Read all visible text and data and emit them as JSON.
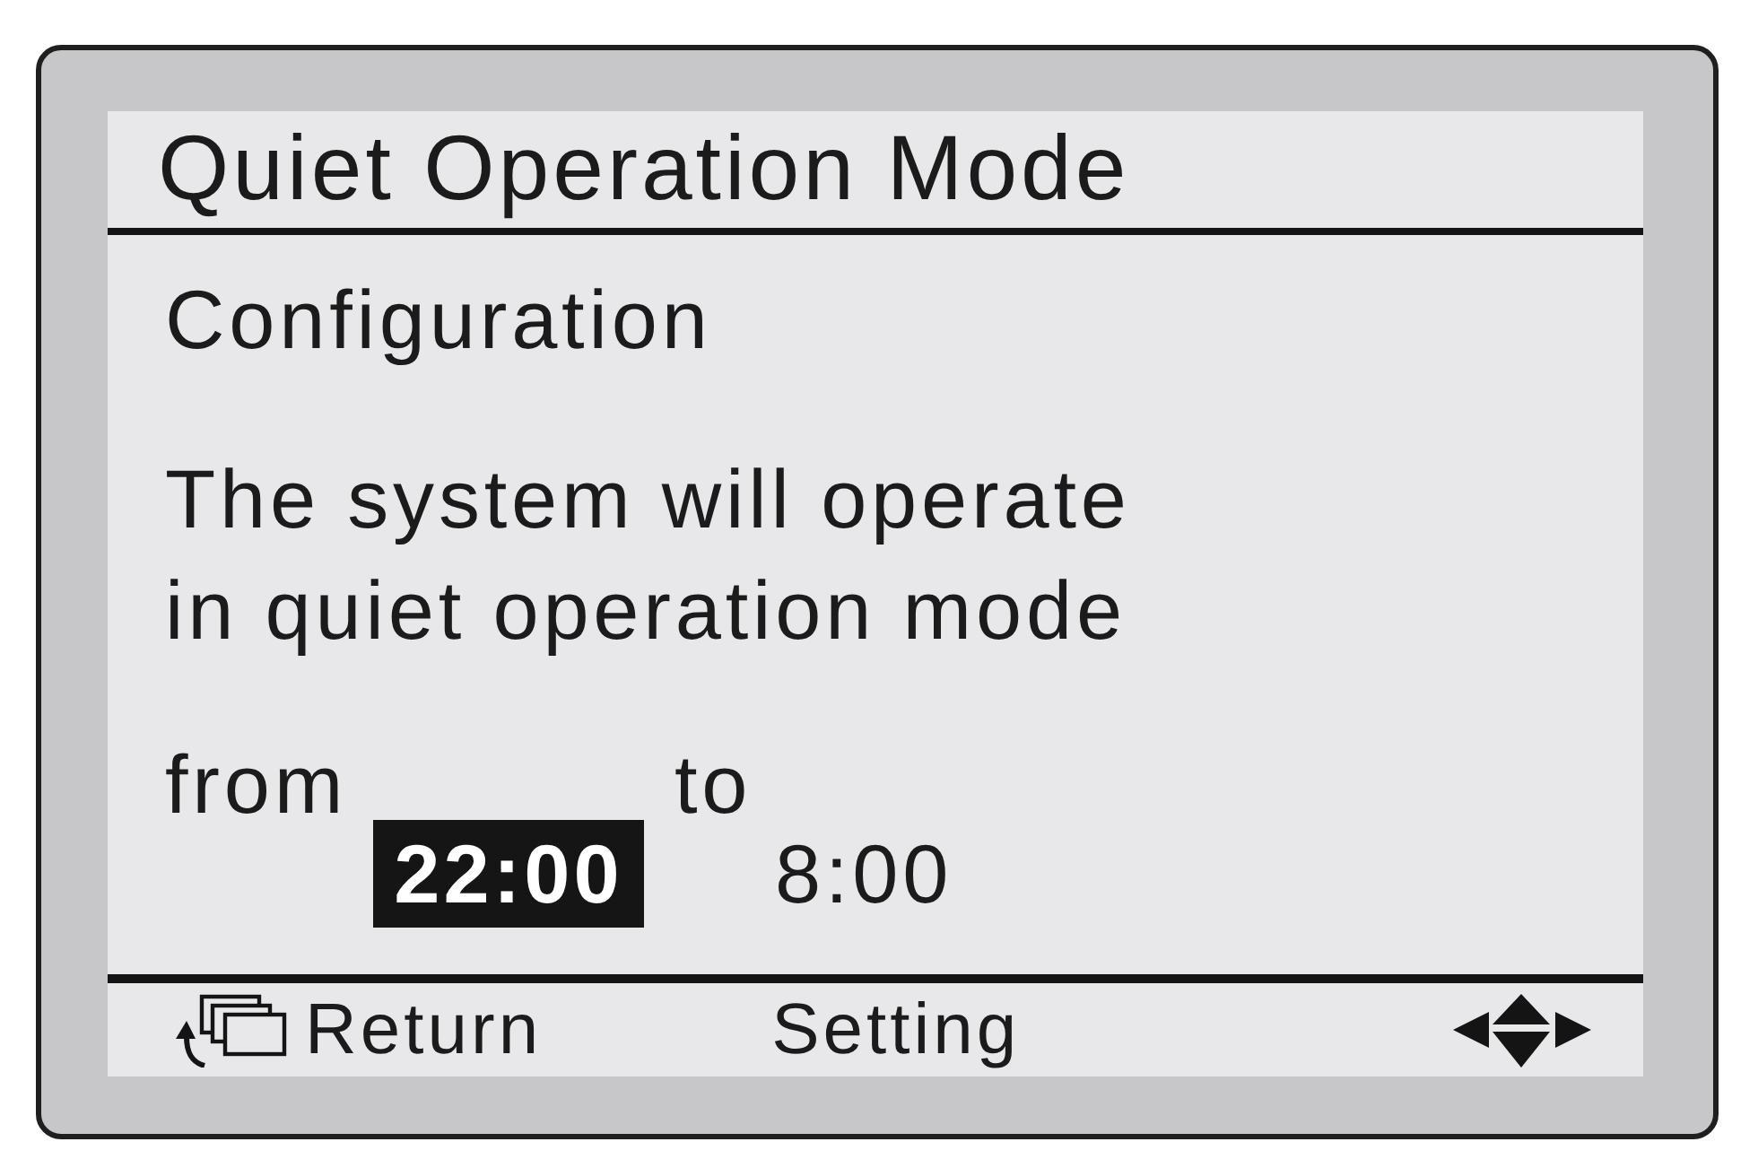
{
  "screen": {
    "title": "Quiet Operation Mode",
    "subtitle": "Configuration"
  },
  "message": "The system will operate in quiet operation mode",
  "schedule": {
    "from_label": "from",
    "to_label": "to",
    "times": [
      {
        "value": "22:00",
        "selected": true
      },
      {
        "value": "8:00",
        "selected": false
      }
    ]
  },
  "footer": {
    "return_label": "Return",
    "center_label": "Setting"
  }
}
